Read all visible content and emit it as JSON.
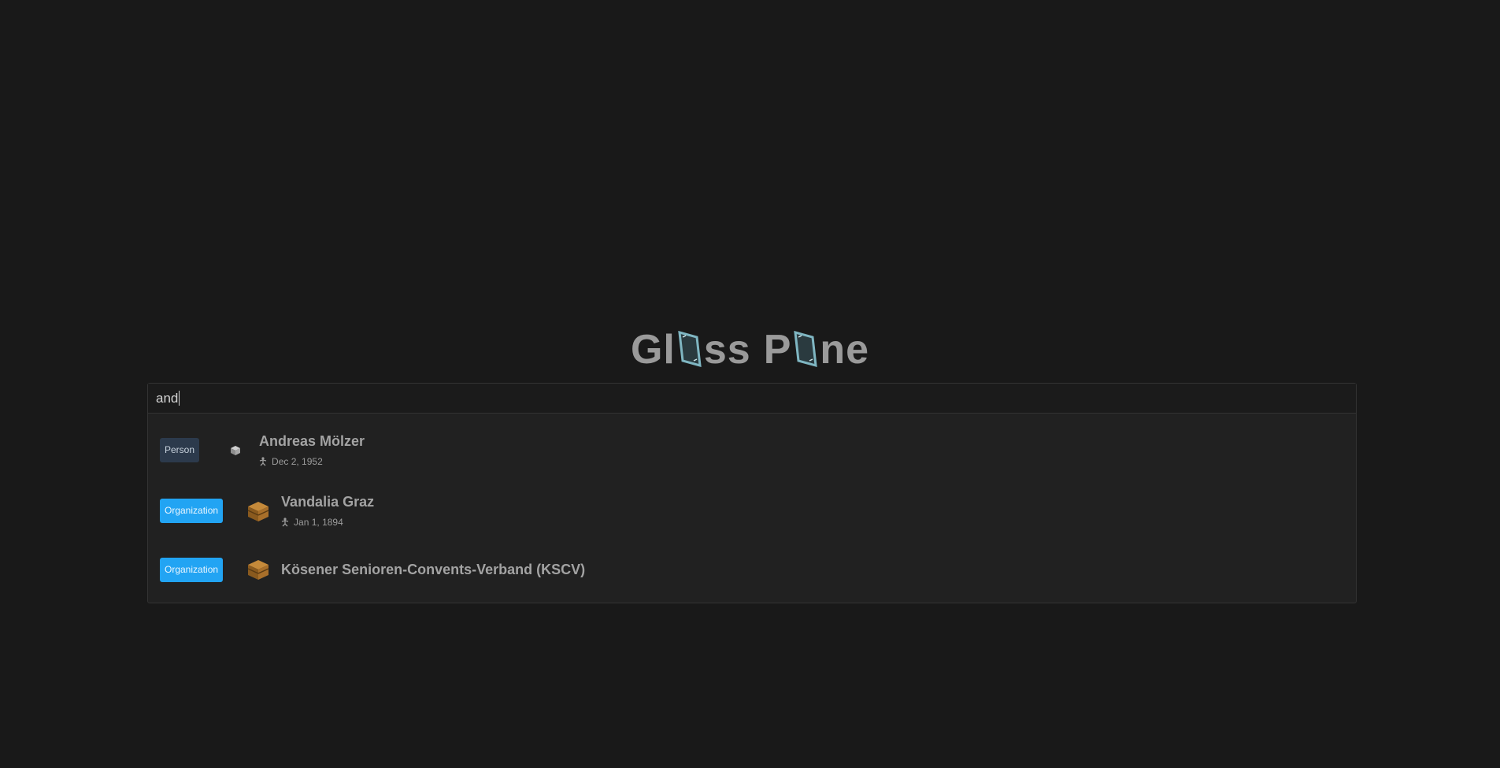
{
  "logo": {
    "part1": "Gl",
    "part2": "ss",
    "part3": "P",
    "part4": "ne",
    "icon": "glass-pane-icon",
    "colors": {
      "text": "#9a9a9a",
      "pane": "#7fb6c2"
    }
  },
  "search": {
    "value": "and",
    "placeholder": ""
  },
  "results": [
    {
      "badge": "Person",
      "badge_color": "#2c3a4c",
      "icon": "cube-icon",
      "title": "Andreas Mölzer",
      "meta_icon": "birth-icon",
      "meta": "Dec 2, 1952"
    },
    {
      "badge": "Organization",
      "badge_color": "#22a4f3",
      "icon": "chest-icon",
      "title": "Vandalia Graz",
      "meta_icon": "birth-icon",
      "meta": "Jan 1, 1894"
    },
    {
      "badge": "Organization",
      "badge_color": "#22a4f3",
      "icon": "chest-icon",
      "title": "Kösener Senioren-Convents-Verband (KSCV)",
      "meta": ""
    }
  ]
}
